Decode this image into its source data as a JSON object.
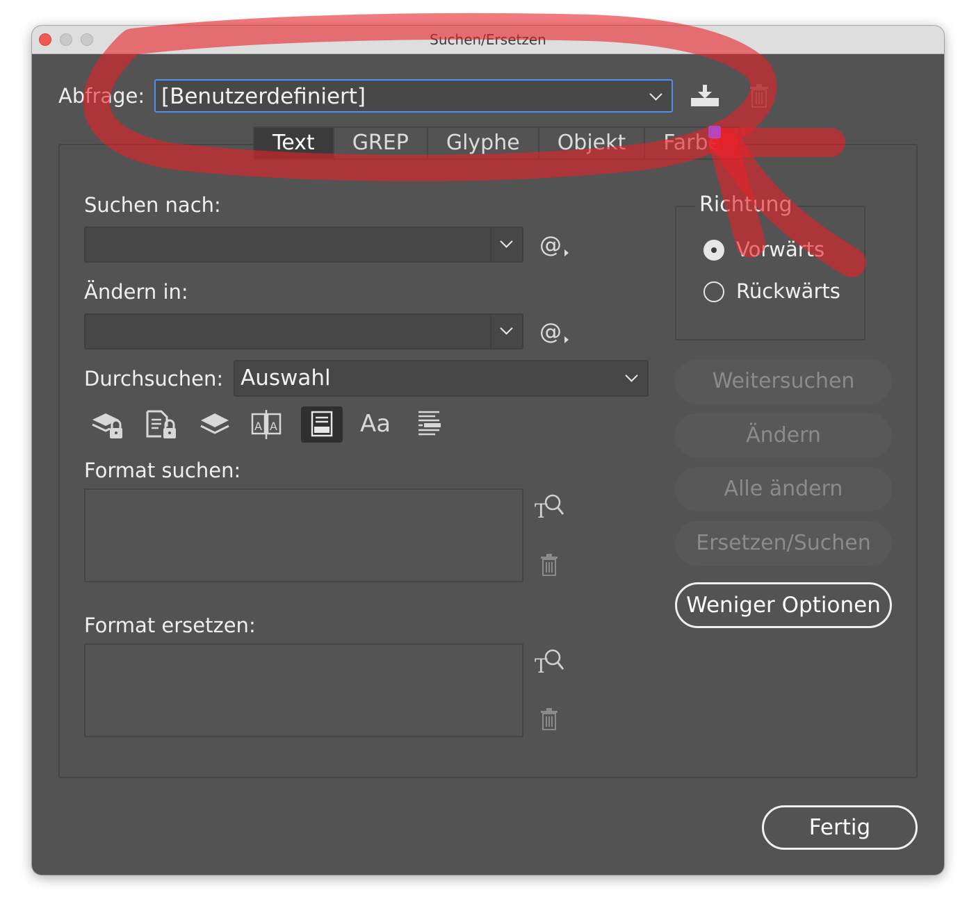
{
  "window": {
    "title": "Suchen/Ersetzen"
  },
  "query": {
    "label": "Abfrage:",
    "value": "[Benutzerdefiniert]"
  },
  "tabs": [
    {
      "label": "Text"
    },
    {
      "label": "GREP"
    },
    {
      "label": "Glyphe"
    },
    {
      "label": "Objekt"
    },
    {
      "label": "Farbe"
    }
  ],
  "search": {
    "label": "Suchen nach:",
    "value": ""
  },
  "replace": {
    "label": "Ändern in:",
    "value": ""
  },
  "scope": {
    "label": "Durchsuchen:",
    "value": "Auswahl"
  },
  "options_icons": [
    "locked-layers-icon",
    "locked-stories-icon",
    "hidden-layers-icon",
    "master-pages-icon",
    "footnotes-icon",
    "case-sensitive-icon",
    "whole-word-icon"
  ],
  "options_text": {
    "case_label": "Aa"
  },
  "format_search": {
    "label": "Format suchen:"
  },
  "format_replace": {
    "label": "Format ersetzen:"
  },
  "direction": {
    "title": "Richtung",
    "options": [
      {
        "label": "Vorwärts",
        "checked": true
      },
      {
        "label": "Rückwärts",
        "checked": false
      }
    ]
  },
  "actions": {
    "find_next": "Weitersuchen",
    "change": "Ändern",
    "change_all": "Alle ändern",
    "change_find": "Ersetzen/Suchen",
    "fewer_options": "Weniger Optionen",
    "done": "Fertig"
  },
  "colors": {
    "annotation": "#e8222a",
    "focus_ring": "#4f8ff0",
    "panel_bg": "#535353"
  }
}
